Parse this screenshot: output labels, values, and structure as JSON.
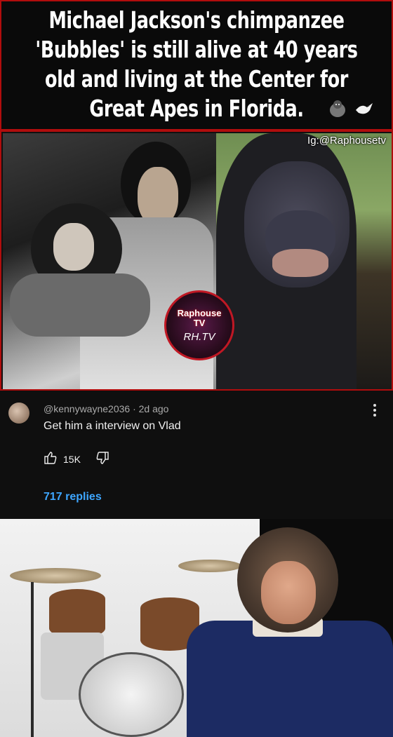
{
  "post": {
    "headline": "Michael Jackson's chimpanzee 'Bubbles' is still alive at 40 years old and living at the Center for Great Apes in Florida.",
    "emojis": [
      "gorilla-icon",
      "dove-icon"
    ],
    "watermark": "Ig:@Raphousetv",
    "logo": {
      "line1": "Raphouse",
      "line2": "TV",
      "sub": "RH.TV"
    }
  },
  "comment": {
    "handle": "@kennywayne2036",
    "separator": "·",
    "time": "2d ago",
    "text": "Get him a interview on Vlad",
    "likes": "15K",
    "replies": "717 replies"
  },
  "colors": {
    "frame_red": "#b10d0d",
    "reply_blue": "#3ea6ff",
    "shirt_navy": "#1c2b63"
  }
}
